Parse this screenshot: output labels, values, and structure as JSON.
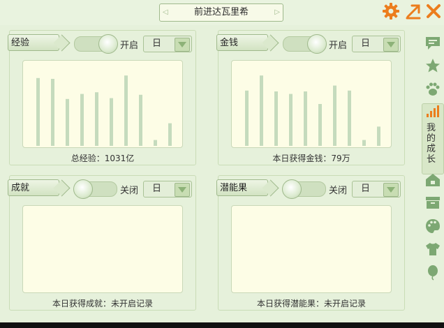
{
  "window": {
    "title": "前进达瓦里希"
  },
  "sidebar": {
    "active_tab": "我的成长"
  },
  "cards": [
    {
      "name": "经验",
      "toggle_label": "开启",
      "select": "日",
      "caption": "总经验：1031亿"
    },
    {
      "name": "金钱",
      "toggle_label": "开启",
      "select": "日",
      "caption": "本日获得金钱：79万"
    },
    {
      "name": "成就",
      "toggle_label": "关闭",
      "select": "日",
      "caption": "本日获得成就：未开启记录"
    },
    {
      "name": "潜能果",
      "toggle_label": "关闭",
      "select": "日",
      "caption": "本日获得潜能果：未开启记录"
    }
  ],
  "chart_data": [
    {
      "type": "bar",
      "series": [
        {
          "values": [
            0.81,
            0.8,
            0.56,
            0.62,
            0.64,
            0.57,
            0.84,
            0.61,
            0.07,
            0.27
          ]
        }
      ]
    },
    {
      "type": "bar",
      "series": [
        {
          "values": [
            0.66,
            0.84,
            0.65,
            0.62,
            0.65,
            0.5,
            0.72,
            0.66,
            0.07,
            0.23
          ]
        }
      ]
    }
  ],
  "icons": [
    "gear-icon",
    "popout-icon",
    "close-icon",
    "message-icon",
    "star-icon",
    "paw-icon",
    "signal-icon",
    "house-icon",
    "box-icon",
    "palette-icon",
    "shirt-icon",
    "balloon-icon"
  ],
  "colors": {
    "bar": "#c5dbbd",
    "plot_bg": "#fdfde6",
    "accent": "#ec7d1d"
  }
}
